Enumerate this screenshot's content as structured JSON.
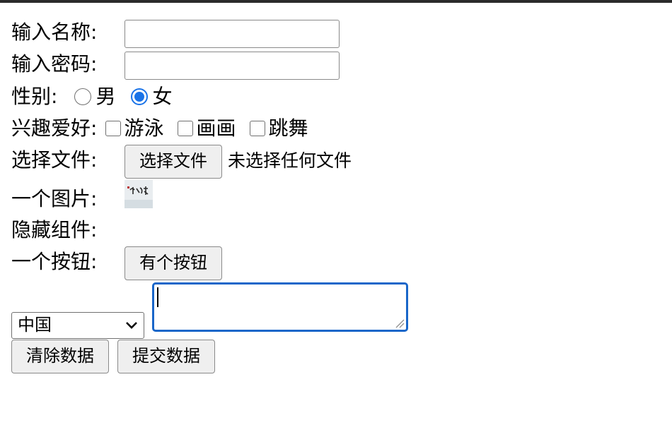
{
  "form": {
    "name_label": "输入名称:",
    "name_value": "",
    "password_label": "输入密码:",
    "password_value": "",
    "gender_label": "性别:",
    "gender_options": [
      "男",
      "女"
    ],
    "gender_selected": "女",
    "hobbies_label": "兴趣爱好:",
    "hobbies": [
      "游泳",
      "画画",
      "跳舞"
    ],
    "file_label": "选择文件:",
    "file_button": "选择文件",
    "file_status": "未选择任何文件",
    "image_label": "一个图片:",
    "hidden_label": "隐藏组件:",
    "button_label": "一个按钮:",
    "button_text": "有个按钮",
    "select_value": "中国",
    "textarea_value": "",
    "reset_button": "清除数据",
    "submit_button": "提交数据"
  },
  "colors": {
    "focus_blue": "#1966c9",
    "radio_checked": "#1a73e8",
    "button_bg": "#efefef"
  },
  "icons": {
    "select_arrow": "chevron-down-icon",
    "textarea_resize": "resize-handle-icon"
  }
}
